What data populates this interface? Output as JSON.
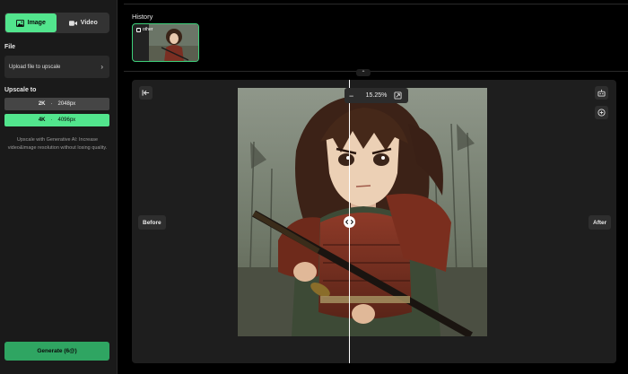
{
  "sidebar": {
    "mode_tabs": [
      {
        "label": "Image",
        "icon": "image-icon",
        "active": true
      },
      {
        "label": "Video",
        "icon": "video-icon",
        "active": false
      }
    ],
    "file_label": "File",
    "upload_label": "Upload file to upscale",
    "upscale_label": "Upscale to",
    "options": [
      {
        "name": "2K",
        "size": "2048px",
        "selected": false
      },
      {
        "name": "4K",
        "size": "4096px",
        "selected": true
      }
    ],
    "description": "Upscale with Generative AI: Increase video&image resolution without losing quality.",
    "generate_label": "Generate (6@)"
  },
  "history": {
    "label": "History",
    "items": [
      {
        "tag": "other"
      }
    ]
  },
  "viewer": {
    "zoom_minus": "−",
    "zoom_value": "15.25%",
    "zoom_plus": "+",
    "before_label": "Before",
    "after_label": "After",
    "compare_position": 0.45
  },
  "colors": {
    "accent": "#52e58d",
    "generate": "#2fa562",
    "panel": "#1a1a1a",
    "canvas": "#1e1e1e"
  }
}
